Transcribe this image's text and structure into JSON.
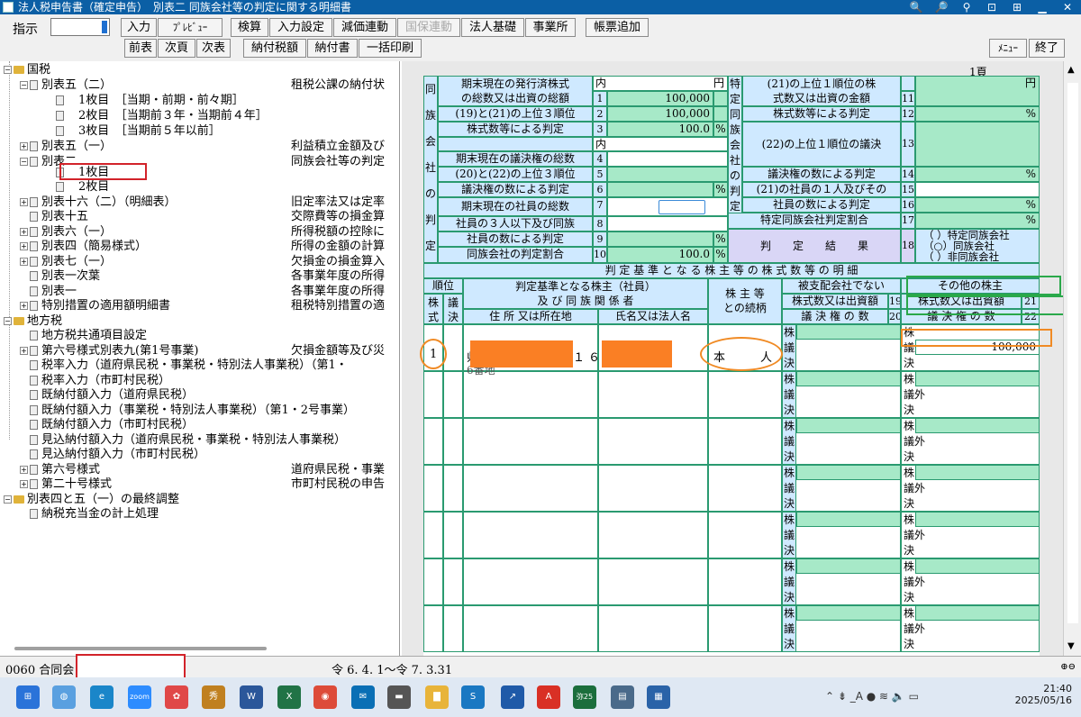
{
  "window": {
    "title": "法人税申告書（確定申告）　別表二 同族会社等の判定に関する明細書",
    "title_icons": [
      "search-zoom-icon",
      "search-doc-icon",
      "search-alt-icon",
      "settings-icon",
      "help-icon",
      "minimize-icon",
      "close-icon"
    ],
    "title_glyphs": [
      "🔍",
      "🔎",
      "⚲",
      "⊡",
      "⊞",
      "▁",
      "✕"
    ]
  },
  "toolbar": {
    "shiji_label": "指示",
    "row1": [
      "入力",
      "ﾌﾟﾚﾋﾞｭｰ",
      "検算",
      "入力設定",
      "減価連動",
      "国保連動",
      "法人基礎",
      "事業所",
      "帳票追加"
    ],
    "row2": [
      "前表",
      "次頁",
      "次表",
      "納付税額",
      "納付書",
      "一括印刷"
    ],
    "menu": "ﾒﾆｭｰ",
    "end": "終了"
  },
  "tree": {
    "nodes": [
      {
        "label": "国税",
        "desc": ""
      },
      {
        "label": "別表五（二）",
        "desc": "租税公課の納付状"
      },
      {
        "label": "1枚目　［当期・前期・前々期］",
        "desc": ""
      },
      {
        "label": "2枚目　［当期前３年・当期前４年］",
        "desc": ""
      },
      {
        "label": "3枚目　［当期前５年以前］",
        "desc": ""
      },
      {
        "label": "別表五（一）",
        "desc": "利益積立金額及び"
      },
      {
        "label": "別表二",
        "desc": "同族会社等の判定"
      },
      {
        "label": "1枚目",
        "desc": ""
      },
      {
        "label": "2枚目",
        "desc": ""
      },
      {
        "label": "別表十六（二）（明細表）",
        "desc": "旧定率法又は定率"
      },
      {
        "label": "別表十五",
        "desc": "交際費等の損金算"
      },
      {
        "label": "別表六（一）",
        "desc": "所得税額の控除に"
      },
      {
        "label": "別表四（簡易様式）",
        "desc": "所得の金額の計算"
      },
      {
        "label": "別表七（一）",
        "desc": "欠損金の損金算入"
      },
      {
        "label": "別表一次葉",
        "desc": "各事業年度の所得"
      },
      {
        "label": "別表一",
        "desc": "各事業年度の所得"
      },
      {
        "label": "特別措置の適用額明細書",
        "desc": "租税特別措置の適"
      },
      {
        "label": "地方税",
        "desc": ""
      },
      {
        "label": "地方税共通項目設定",
        "desc": ""
      },
      {
        "label": "第六号様式別表九(第1号事業)",
        "desc": "欠損金額等及び災"
      },
      {
        "label": "税率入力（道府県民税・事業税・特別法人事業税）（第1・",
        "desc": ""
      },
      {
        "label": "税率入力（市町村民税）",
        "desc": ""
      },
      {
        "label": "既納付額入力（道府県民税）",
        "desc": ""
      },
      {
        "label": "既納付額入力（事業税・特別法人事業税）（第1・2号事業）",
        "desc": ""
      },
      {
        "label": "既納付額入力（市町村民税）",
        "desc": ""
      },
      {
        "label": "見込納付額入力（道府県民税・事業税・特別法人事業税）",
        "desc": ""
      },
      {
        "label": "見込納付額入力（市町村民税）",
        "desc": ""
      },
      {
        "label": "第六号様式",
        "desc": "道府県民税・事業"
      },
      {
        "label": "第二十号様式",
        "desc": "市町村民税の申告"
      },
      {
        "label": "別表四と五（一）の最終調整",
        "desc": ""
      },
      {
        "label": "納税充当金の計上処理",
        "desc": ""
      }
    ]
  },
  "form": {
    "page": "1頁",
    "left_vlabel": [
      "同",
      "族",
      "会",
      "社",
      "の",
      "判",
      "定"
    ],
    "mid_vlabel": [
      "特",
      "定",
      "同",
      "族",
      "会",
      "社",
      "の",
      "判",
      "定"
    ],
    "rows_left": [
      {
        "label": "期末現在の発行済株式",
        "label2": "の総数又は出資の総額",
        "no": "1",
        "value": "100,000",
        "unit": "円",
        "pre": "内"
      },
      {
        "label": "(19)と(21)の上位３順位",
        "no": "2",
        "value": "100,000"
      },
      {
        "label": "株式数等による判定",
        "no": "3",
        "value": "100.0",
        "unit": "%"
      },
      {
        "label": "期末現在の議決権の総数",
        "no": "4",
        "value": "",
        "pre": "内"
      },
      {
        "label": "(20)と(22)の上位３順位",
        "no": "5",
        "value": ""
      },
      {
        "label": "議決権の数による判定",
        "no": "6",
        "value": "",
        "unit": "%"
      },
      {
        "label": "期末現在の社員の総数",
        "no": "7",
        "value": ""
      },
      {
        "label": "社員の３人以下及び同族",
        "no": "8",
        "value": ""
      },
      {
        "label": "社員の数による判定",
        "no": "9",
        "value": "",
        "unit": "%"
      },
      {
        "label": "同族会社の判定割合",
        "no": "10",
        "value": "100.0",
        "unit": "%"
      }
    ],
    "rows_right": [
      {
        "label": "(21)の上位１順位の株",
        "label2": "式数又は出資の金額",
        "no": "11",
        "value": "",
        "unit": "円"
      },
      {
        "label": "株式数等による判定",
        "no": "12",
        "value": "",
        "unit": "%"
      },
      {
        "label": "(22)の上位１順位の議決",
        "no": "13",
        "value": ""
      },
      {
        "label": "議決権の数による判定",
        "no": "14",
        "value": "",
        "unit": "%"
      },
      {
        "label": "(21)の社員の１人及びその",
        "no": "15",
        "value": ""
      },
      {
        "label": "社員の数による判定",
        "no": "16",
        "value": "",
        "unit": "%"
      },
      {
        "label": "特定同族会社判定割合",
        "no": "17",
        "value": "",
        "unit": "%"
      }
    ],
    "judgement_label": "判　　定　　結　　果",
    "judgement_no": "18",
    "judgement_options": [
      "（ ）特定同族会社",
      "（○）同族会社",
      "（ ）非同族会社"
    ],
    "section_title": "判 定 基 準 と な る 株 主 等 の 株 式 数 等 の 明 細",
    "hdr": {
      "juni": "順位",
      "kabu": "株式",
      "gi": "議決",
      "kijun": "判定基準となる株主（社員）",
      "kijun2": "及 び 同 族 関 係 者",
      "address": "住 所 又は所在地",
      "name": "氏名又は法人名",
      "relation": "株 主 等",
      "relation2": "との続柄",
      "hishihai": "被支配会社でない",
      "other": "その他の株主",
      "kabu_num_a": "株式数又は出資額",
      "no19": "19",
      "kabu_num_b": "株式数又は出資額",
      "no21": "21",
      "giketsu_a": "議 決 権 の 数",
      "no20": "20",
      "giketsu_b": "議 決 権 の 数",
      "no22": "22"
    },
    "entry": {
      "rank": "1",
      "address_partial": "県",
      "address_num": "１６",
      "address_line2": "6番地",
      "relation": "本　　　人",
      "kabu_mark": "株",
      "gi_mark": "議",
      "ketsu_mark": "決",
      "gai_mark": "議外",
      "other_shares": "100,000"
    }
  },
  "statusbar": {
    "code": "0060 合同会",
    "period": "令 6. 4. 1～令 7. 3.31",
    "zoom_in": "⊕",
    "zoom_out": "⊖"
  },
  "taskbar": {
    "apps": [
      {
        "name": "start-icon",
        "glyph": "⊞",
        "color": "#2a73d9"
      },
      {
        "name": "earth-icon",
        "glyph": "◍",
        "color": "#5aa0e0"
      },
      {
        "name": "edge-icon",
        "glyph": "e",
        "color": "#1a86c9"
      },
      {
        "name": "zoom-icon",
        "glyph": "zoom",
        "color": "#2d8cff"
      },
      {
        "name": "flower-icon",
        "glyph": "✿",
        "color": "#e04848"
      },
      {
        "name": "kanji-app-icon",
        "glyph": "秀",
        "color": "#c08020"
      },
      {
        "name": "word-icon",
        "glyph": "W",
        "color": "#2b579a"
      },
      {
        "name": "excel-icon",
        "glyph": "X",
        "color": "#217346"
      },
      {
        "name": "chrome-icon",
        "glyph": "◉",
        "color": "#dd4b39"
      },
      {
        "name": "mail-icon",
        "glyph": "✉",
        "color": "#0a6fb5"
      },
      {
        "name": "pen-icon",
        "glyph": "▬",
        "color": "#555"
      },
      {
        "name": "folder-icon",
        "glyph": "▇",
        "color": "#e8b43a"
      },
      {
        "name": "s-app-icon",
        "glyph": "S",
        "color": "#1a78c2"
      },
      {
        "name": "arrow-app-icon",
        "glyph": "↗",
        "color": "#1f5aa8"
      },
      {
        "name": "pdf-icon",
        "glyph": "A",
        "color": "#d93025"
      },
      {
        "name": "yayoi-icon",
        "glyph": "弥25",
        "color": "#1b6e3c"
      },
      {
        "name": "scanner-icon",
        "glyph": "▤",
        "color": "#4a6a8a"
      },
      {
        "name": "tax-app-icon",
        "glyph": "▦",
        "color": "#2a63a8"
      }
    ],
    "tray_glyphs": "⌃  ⇟  _A   ●   ≋  🔈  ▭",
    "time": "21:40",
    "date": "2025/05/16"
  }
}
